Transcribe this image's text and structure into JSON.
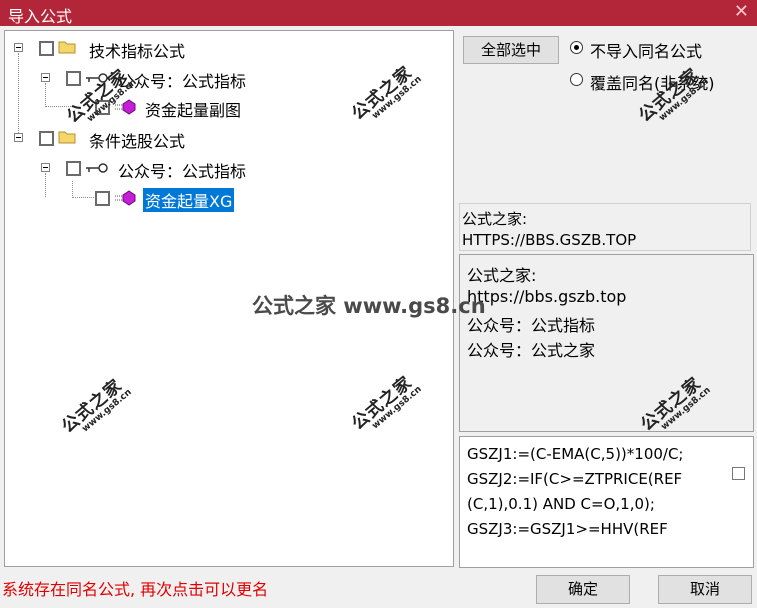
{
  "window": {
    "title": "导入公式",
    "close_glyph": "✕"
  },
  "tree": {
    "nodes": [
      {
        "label": "技术指标公式",
        "icon": "folder-icon"
      },
      {
        "label": "公众号：公式指标",
        "icon": "key-icon"
      },
      {
        "label": "资金起量副图",
        "icon": "formula-icon"
      },
      {
        "label": "条件选股公式",
        "icon": "folder-icon"
      },
      {
        "label": "公众号：公式指标",
        "icon": "key-icon"
      },
      {
        "label": "资金起量XG",
        "icon": "formula-icon",
        "selected": true
      }
    ]
  },
  "options": {
    "select_all": "全部选中",
    "radio_no_import": "不导入同名公式",
    "radio_overwrite": "覆盖同名(非系统)",
    "selected_radio": "radio_no_import"
  },
  "info": {
    "line1": "公式之家:",
    "line2": "HTTPS://BBS.GSZB.TOP"
  },
  "description": [
    "公式之家:",
    "https://bbs.gszb.top",
    "公众号：公式指标",
    "公众号：公式之家"
  ],
  "code_lines": [
    "GSZJ1:=(C-EMA(C,5))*100/C;",
    "GSZJ2:=IF(C>=ZTPRICE(REF",
    "(C,1),0.1) AND C=O,1,0);",
    "GSZJ3:=GSZJ1>=HHV(REF"
  ],
  "status_text": "系统存在同名公式, 再次点击可以更名",
  "buttons": {
    "ok": "确定",
    "cancel": "取消"
  },
  "watermark": {
    "main": "公式之家",
    "url": "www.gs8.cn",
    "center": "公式之家 www.gs8.cn"
  },
  "colors": {
    "titlebar": "#b3263a",
    "selection": "#0078d7",
    "status": "#e00000"
  }
}
